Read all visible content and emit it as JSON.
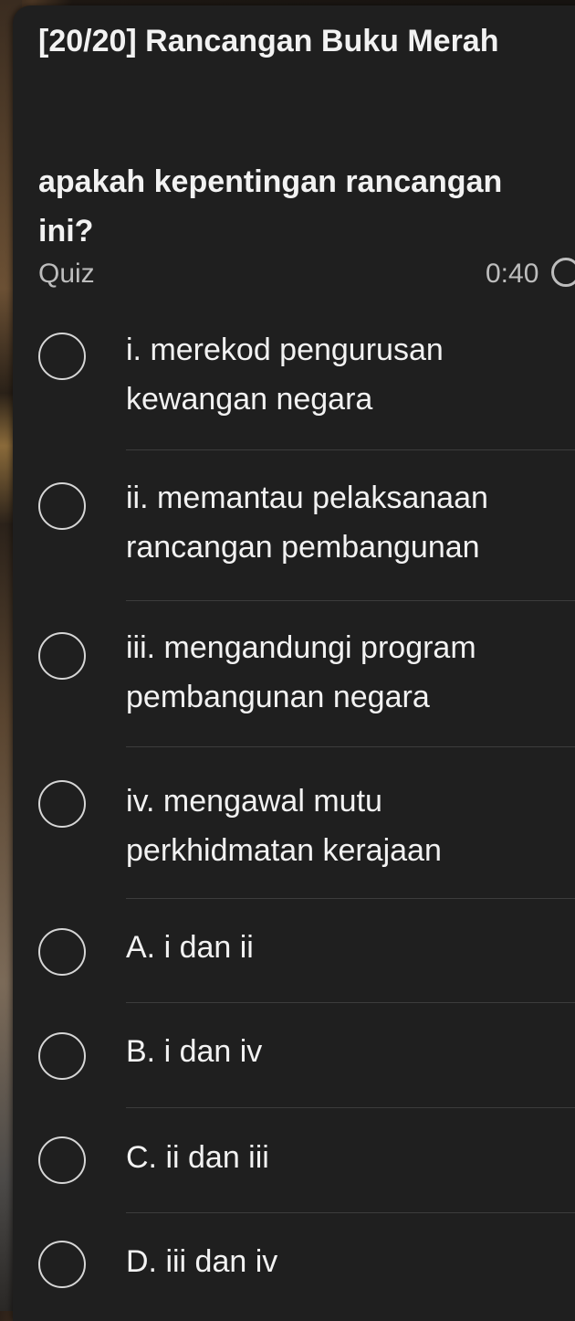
{
  "quiz": {
    "title": "[20/20] Rancangan Buku Merah",
    "question": "apakah kepentingan rancangan ini?",
    "label": "Quiz",
    "timer": "0:40"
  },
  "options": [
    {
      "label": "i. merekod pengurusan kewangan negara"
    },
    {
      "label": "ii. memantau pelaksanaan rancangan pembangunan"
    },
    {
      "label": "iii. mengandungi program pembangunan negara"
    },
    {
      "label": "iv. mengawal mutu perkhidmatan kerajaan"
    },
    {
      "label": "A. i dan ii"
    },
    {
      "label": "B. i dan iv"
    },
    {
      "label": "C. ii dan iii"
    },
    {
      "label": "D. iii dan iv"
    }
  ],
  "icons": {
    "radio": "radio-unchecked-icon",
    "timer": "timer-ring-icon"
  }
}
